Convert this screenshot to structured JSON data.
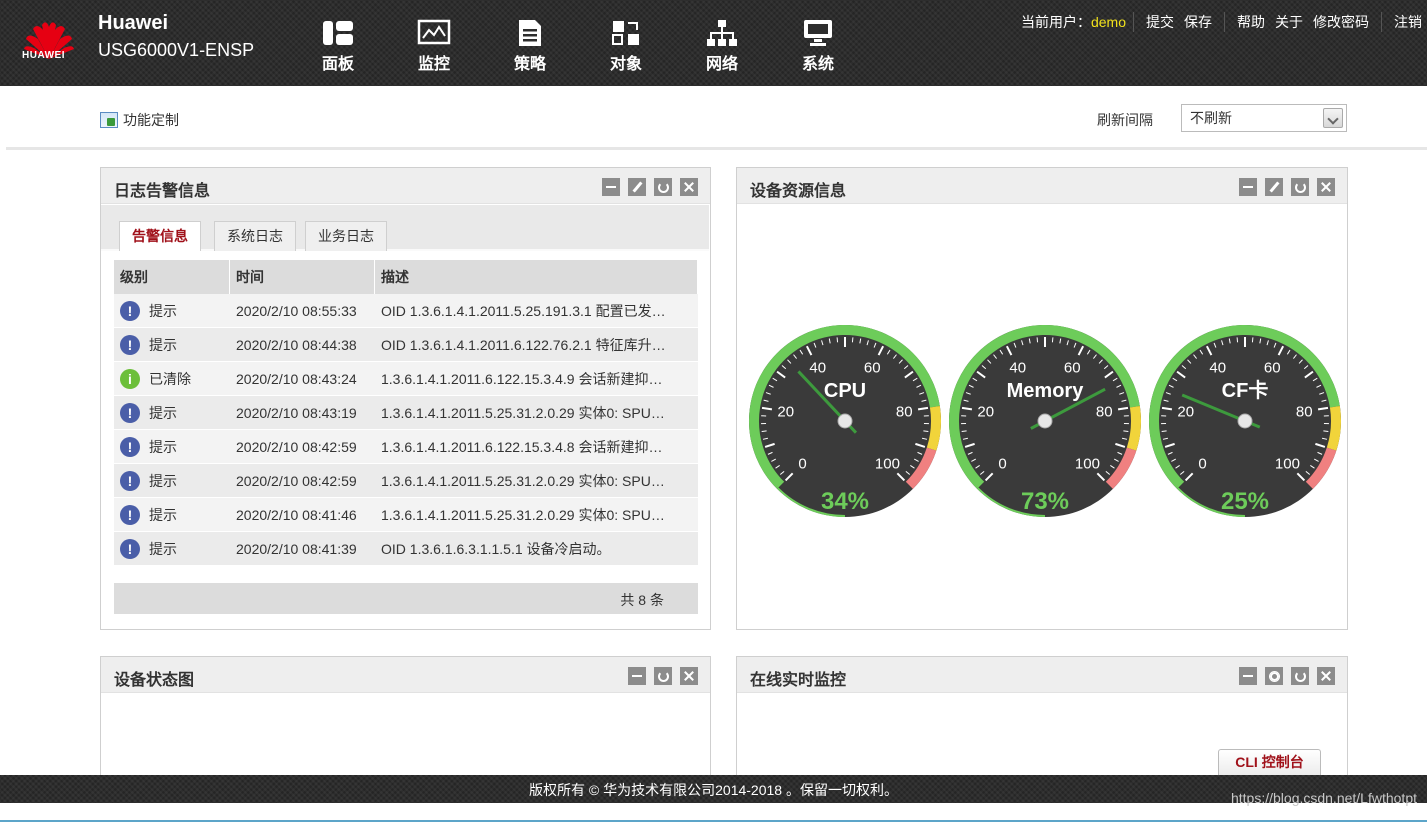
{
  "header": {
    "logo_text": "HUAWEI",
    "brand": "Huawei",
    "model": "USG6000V1-ENSP",
    "nav": [
      {
        "label": "面板",
        "icon": "dashboard-icon"
      },
      {
        "label": "监控",
        "icon": "monitor-icon"
      },
      {
        "label": "策略",
        "icon": "policy-icon"
      },
      {
        "label": "对象",
        "icon": "object-icon"
      },
      {
        "label": "网络",
        "icon": "network-icon"
      },
      {
        "label": "系统",
        "icon": "system-icon"
      }
    ],
    "user_label": "当前用户：",
    "user_name": "demo",
    "links": {
      "submit": "提交",
      "save": "保存",
      "help": "帮助",
      "about": "关于",
      "change_password": "修改密码",
      "logout": "注销"
    }
  },
  "toolbar": {
    "function_custom": "功能定制",
    "refresh_label": "刷新间隔",
    "refresh_value": "不刷新"
  },
  "log_panel": {
    "title": "日志告警信息",
    "tabs": [
      "告警信息",
      "系统日志",
      "业务日志"
    ],
    "columns": [
      "级别",
      "时间",
      "描述"
    ],
    "rows": [
      {
        "level": "提示",
        "type": "warn",
        "time": "2020/2/10 08:55:33",
        "desc": "OID 1.3.6.1.4.1.2011.5.25.191.3.1 配置已发…"
      },
      {
        "level": "提示",
        "type": "warn",
        "time": "2020/2/10 08:44:38",
        "desc": "OID 1.3.6.1.4.1.2011.6.122.76.2.1 特征库升…"
      },
      {
        "level": "已清除",
        "type": "info",
        "time": "2020/2/10 08:43:24",
        "desc": "1.3.6.1.4.1.2011.6.122.15.3.4.9 会话新建抑…"
      },
      {
        "level": "提示",
        "type": "warn",
        "time": "2020/2/10 08:43:19",
        "desc": "1.3.6.1.4.1.2011.5.25.31.2.0.29 实体0: SPU…"
      },
      {
        "level": "提示",
        "type": "warn",
        "time": "2020/2/10 08:42:59",
        "desc": "1.3.6.1.4.1.2011.6.122.15.3.4.8 会话新建抑…"
      },
      {
        "level": "提示",
        "type": "warn",
        "time": "2020/2/10 08:42:59",
        "desc": "1.3.6.1.4.1.2011.5.25.31.2.0.29 实体0: SPU…"
      },
      {
        "level": "提示",
        "type": "warn",
        "time": "2020/2/10 08:41:46",
        "desc": "1.3.6.1.4.1.2011.5.25.31.2.0.29 实体0: SPU…"
      },
      {
        "level": "提示",
        "type": "warn",
        "time": "2020/2/10 08:41:39",
        "desc": "OID 1.3.6.1.6.3.1.1.5.1 设备冷启动。"
      }
    ],
    "footer": "共 8 条"
  },
  "resource_panel": {
    "title": "设备资源信息",
    "gauges": [
      {
        "label": "CPU",
        "value": 34,
        "display": "34%"
      },
      {
        "label": "Memory",
        "value": 73,
        "display": "73%"
      },
      {
        "label": "CF卡",
        "value": 25,
        "display": "25%"
      }
    ],
    "ticks": [
      "0",
      "20",
      "40",
      "60",
      "80",
      "100"
    ]
  },
  "status_panel": {
    "title": "设备状态图"
  },
  "monitor_panel": {
    "title": "在线实时监控"
  },
  "cli_button": "CLI 控制台",
  "footer": {
    "copyright": "版权所有 © 华为技术有限公司2014-2018 。保留一切权利。"
  },
  "watermark": "https://blog.csdn.net/Lfwthotpt",
  "colors": {
    "accent": "#a0111a",
    "user": "#f2e21c",
    "gauge_green": "#6dcc5a",
    "gauge_yellow": "#f1d43b",
    "gauge_red": "#f08080"
  }
}
